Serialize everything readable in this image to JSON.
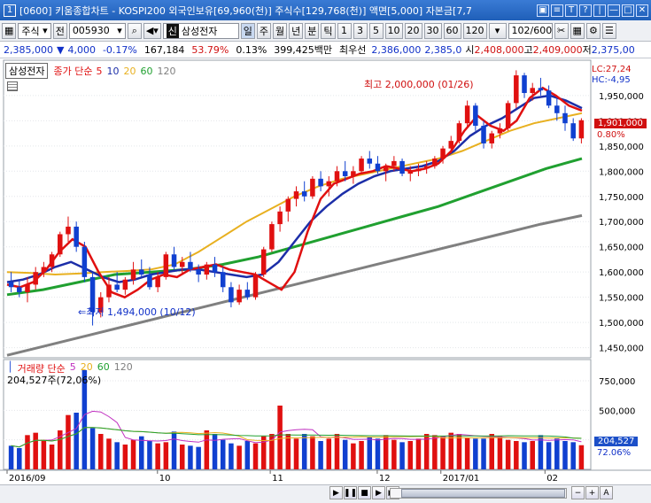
{
  "window": {
    "number": "1",
    "title": "[0600] 키움종합차트 - KOSPI200 외국인보유[69,960(천)] 주식수[129,768(천)] 액면[5,000] 자본금[7,7",
    "buttons": [
      "▣",
      "≡",
      "T",
      "?",
      "|",
      "—",
      "□",
      "✕"
    ]
  },
  "toolbar": {
    "market": "주식",
    "market_option": "전",
    "code": "005930",
    "stock_name": "삼성전자",
    "badge": "신",
    "period_tag": "일",
    "periods": [
      "주",
      "월",
      "년",
      "분",
      "틱"
    ],
    "intervals": [
      "1",
      "3",
      "5",
      "10",
      "20",
      "30",
      "60",
      "120"
    ],
    "count": "102/600"
  },
  "quote": {
    "price": "2,385,000",
    "change": "4,000",
    "change_pct": "-0.17%",
    "volume": "167,184",
    "vol_ratio": "53.79%",
    "turnover": "0.13%",
    "amount": "399,425백만",
    "pref_label": "최우선",
    "ask": "2,386,000",
    "bid": "2,385,0",
    "open_label": "시",
    "open": "2,408,000",
    "high_label": "고",
    "high": "2,409,000",
    "low_label": "저",
    "low": "2,375,00"
  },
  "legend": {
    "name": "삼성전자",
    "ma_title": "종가 단순",
    "ma": [
      "5",
      "10",
      "20",
      "60",
      "120"
    ],
    "lc": "LC:27,24",
    "hc": "HC:-4,95"
  },
  "annotations": {
    "high": "최고 2,000,000 (01/26)",
    "low": "최저 1,494,000 (10/12)",
    "current_price": "1,901,000",
    "current_pct": "0.80%",
    "volume_current": "204,527",
    "volume_pct": "72.06%"
  },
  "volume_panel": {
    "title": "거래량 단순",
    "ma": [
      "5",
      "20",
      "60",
      "120"
    ],
    "current": "204,527주(72,06%)"
  },
  "colors": {
    "ma5": "#e01010",
    "ma10": "#1c2ea8",
    "ma20": "#e8b020",
    "ma60": "#20a030",
    "ma120": "#808080",
    "up": "#e01010",
    "down": "#1040d0"
  },
  "chart_data": [
    {
      "type": "candlestick",
      "title": "삼성전자",
      "x_labels": [
        "2016/09",
        "10",
        "11",
        "12",
        "2017/01",
        "02"
      ],
      "ylim": [
        1430000,
        2020000
      ],
      "y_ticks": [
        "1,950,000",
        "1,900,000",
        "1,850,000",
        "1,800,000",
        "1,750,000",
        "1,700,000",
        "1,650,000",
        "1,600,000",
        "1,550,000",
        "1,500,000",
        "1,450,000"
      ],
      "ohlc": [
        [
          1580000,
          1600000,
          1560000,
          1570000
        ],
        [
          1570000,
          1585000,
          1550000,
          1560000
        ],
        [
          1560000,
          1590000,
          1540000,
          1575000
        ],
        [
          1575000,
          1610000,
          1565000,
          1600000
        ],
        [
          1600000,
          1620000,
          1590000,
          1610000
        ],
        [
          1610000,
          1640000,
          1600000,
          1635000
        ],
        [
          1635000,
          1680000,
          1630000,
          1675000
        ],
        [
          1675000,
          1710000,
          1660000,
          1690000
        ],
        [
          1690000,
          1700000,
          1640000,
          1650000
        ],
        [
          1650000,
          1660000,
          1580000,
          1590000
        ],
        [
          1590000,
          1600000,
          1494000,
          1520000
        ],
        [
          1520000,
          1560000,
          1510000,
          1550000
        ],
        [
          1550000,
          1590000,
          1540000,
          1575000
        ],
        [
          1575000,
          1600000,
          1560000,
          1565000
        ],
        [
          1565000,
          1590000,
          1555000,
          1585000
        ],
        [
          1585000,
          1620000,
          1575000,
          1605000
        ],
        [
          1605000,
          1625000,
          1590000,
          1595000
        ],
        [
          1595000,
          1610000,
          1565000,
          1570000
        ],
        [
          1570000,
          1600000,
          1560000,
          1590000
        ],
        [
          1590000,
          1640000,
          1585000,
          1635000
        ],
        [
          1635000,
          1650000,
          1605000,
          1610000
        ],
        [
          1610000,
          1630000,
          1595000,
          1620000
        ],
        [
          1620000,
          1640000,
          1600000,
          1605000
        ],
        [
          1605000,
          1615000,
          1580000,
          1595000
        ],
        [
          1595000,
          1620000,
          1585000,
          1615000
        ],
        [
          1615000,
          1630000,
          1590000,
          1600000
        ],
        [
          1600000,
          1610000,
          1560000,
          1570000
        ],
        [
          1570000,
          1580000,
          1530000,
          1540000
        ],
        [
          1540000,
          1575000,
          1535000,
          1565000
        ],
        [
          1565000,
          1580000,
          1545000,
          1550000
        ],
        [
          1550000,
          1600000,
          1545000,
          1595000
        ],
        [
          1595000,
          1650000,
          1590000,
          1645000
        ],
        [
          1645000,
          1700000,
          1640000,
          1695000
        ],
        [
          1695000,
          1730000,
          1680000,
          1720000
        ],
        [
          1720000,
          1750000,
          1700000,
          1745000
        ],
        [
          1745000,
          1770000,
          1730000,
          1760000
        ],
        [
          1760000,
          1780000,
          1740000,
          1750000
        ],
        [
          1750000,
          1790000,
          1745000,
          1785000
        ],
        [
          1785000,
          1800000,
          1760000,
          1770000
        ],
        [
          1770000,
          1790000,
          1750000,
          1780000
        ],
        [
          1780000,
          1810000,
          1770000,
          1800000
        ],
        [
          1800000,
          1820000,
          1780000,
          1790000
        ],
        [
          1790000,
          1810000,
          1775000,
          1800000
        ],
        [
          1800000,
          1830000,
          1795000,
          1825000
        ],
        [
          1825000,
          1840000,
          1805000,
          1815000
        ],
        [
          1815000,
          1830000,
          1795000,
          1800000
        ],
        [
          1800000,
          1815000,
          1780000,
          1810000
        ],
        [
          1810000,
          1830000,
          1800000,
          1820000
        ],
        [
          1820000,
          1825000,
          1790000,
          1795000
        ],
        [
          1795000,
          1810000,
          1780000,
          1800000
        ],
        [
          1800000,
          1815000,
          1790000,
          1805000
        ],
        [
          1805000,
          1820000,
          1795000,
          1810000
        ],
        [
          1810000,
          1830000,
          1805000,
          1825000
        ],
        [
          1825000,
          1850000,
          1815000,
          1845000
        ],
        [
          1845000,
          1870000,
          1835000,
          1860000
        ],
        [
          1860000,
          1900000,
          1855000,
          1895000
        ],
        [
          1895000,
          1940000,
          1885000,
          1930000
        ],
        [
          1930000,
          1935000,
          1880000,
          1890000
        ],
        [
          1890000,
          1900000,
          1845000,
          1855000
        ],
        [
          1855000,
          1880000,
          1845000,
          1875000
        ],
        [
          1875000,
          1895000,
          1865000,
          1885000
        ],
        [
          1885000,
          1940000,
          1880000,
          1935000
        ],
        [
          1935000,
          2000000,
          1925000,
          1990000
        ],
        [
          1990000,
          1995000,
          1945000,
          1955000
        ],
        [
          1955000,
          1975000,
          1940000,
          1965000
        ],
        [
          1965000,
          1985000,
          1950000,
          1960000
        ],
        [
          1960000,
          1970000,
          1925000,
          1930000
        ],
        [
          1930000,
          1945000,
          1900000,
          1915000
        ],
        [
          1915000,
          1930000,
          1880000,
          1895000
        ],
        [
          1895000,
          1905000,
          1860000,
          1865000
        ],
        [
          1865000,
          1905000,
          1855000,
          1901000
        ]
      ],
      "ma5": [
        1575000,
        1570000,
        1580000,
        1605000,
        1640000,
        1665000,
        1650000,
        1600000,
        1560000,
        1550000,
        1565000,
        1585000,
        1595000,
        1590000,
        1605000,
        1610000,
        1615000,
        1605000,
        1600000,
        1595000,
        1580000,
        1565000,
        1600000,
        1680000,
        1745000,
        1775000,
        1785000,
        1795000,
        1800000,
        1810000,
        1805000,
        1800000,
        1805000,
        1815000,
        1840000,
        1880000,
        1910000,
        1890000,
        1880000,
        1900000,
        1945000,
        1965000,
        1950000,
        1930000,
        1920000
      ],
      "ma10": [
        1580000,
        1585000,
        1595000,
        1610000,
        1620000,
        1605000,
        1590000,
        1580000,
        1585000,
        1595000,
        1600000,
        1605000,
        1605000,
        1600000,
        1595000,
        1590000,
        1595000,
        1620000,
        1660000,
        1700000,
        1730000,
        1755000,
        1775000,
        1790000,
        1800000,
        1805000,
        1810000,
        1820000,
        1840000,
        1870000,
        1890000,
        1905000,
        1925000,
        1945000,
        1950000,
        1940000,
        1925000
      ],
      "ma20": [
        1600000,
        1598000,
        1595000,
        1597000,
        1600000,
        1602000,
        1605000,
        1615000,
        1640000,
        1670000,
        1700000,
        1725000,
        1750000,
        1770000,
        1785000,
        1795000,
        1805000,
        1815000,
        1825000,
        1840000,
        1860000,
        1880000,
        1895000,
        1905000,
        1915000
      ],
      "ma60": [
        1555000,
        1565000,
        1580000,
        1595000,
        1600000,
        1605000,
        1615000,
        1630000,
        1650000,
        1670000,
        1690000,
        1710000,
        1730000,
        1755000,
        1780000,
        1805000,
        1825000
      ],
      "ma120": [
        1435000,
        1455000,
        1475000,
        1495000,
        1515000,
        1535000,
        1555000,
        1575000,
        1595000,
        1615000,
        1635000,
        1655000,
        1675000,
        1695000,
        1712000
      ]
    },
    {
      "type": "bar",
      "title": "거래량",
      "ylim": [
        0,
        900000
      ],
      "y_ticks": [
        "750,000",
        "500,000",
        "250,000"
      ],
      "values": [
        200000,
        180000,
        290000,
        310000,
        250000,
        210000,
        330000,
        460000,
        480000,
        840000,
        350000,
        300000,
        260000,
        230000,
        210000,
        250000,
        280000,
        240000,
        220000,
        230000,
        320000,
        210000,
        200000,
        190000,
        330000,
        300000,
        250000,
        220000,
        200000,
        240000,
        220000,
        280000,
        300000,
        540000,
        300000,
        260000,
        300000,
        280000,
        240000,
        260000,
        300000,
        250000,
        220000,
        240000,
        270000,
        260000,
        290000,
        250000,
        230000,
        240000,
        260000,
        300000,
        290000,
        280000,
        310000,
        300000,
        270000,
        260000,
        260000,
        300000,
        280000,
        250000,
        240000,
        230000,
        240000,
        290000,
        230000,
        260000,
        240000,
        230000,
        204527
      ]
    }
  ]
}
